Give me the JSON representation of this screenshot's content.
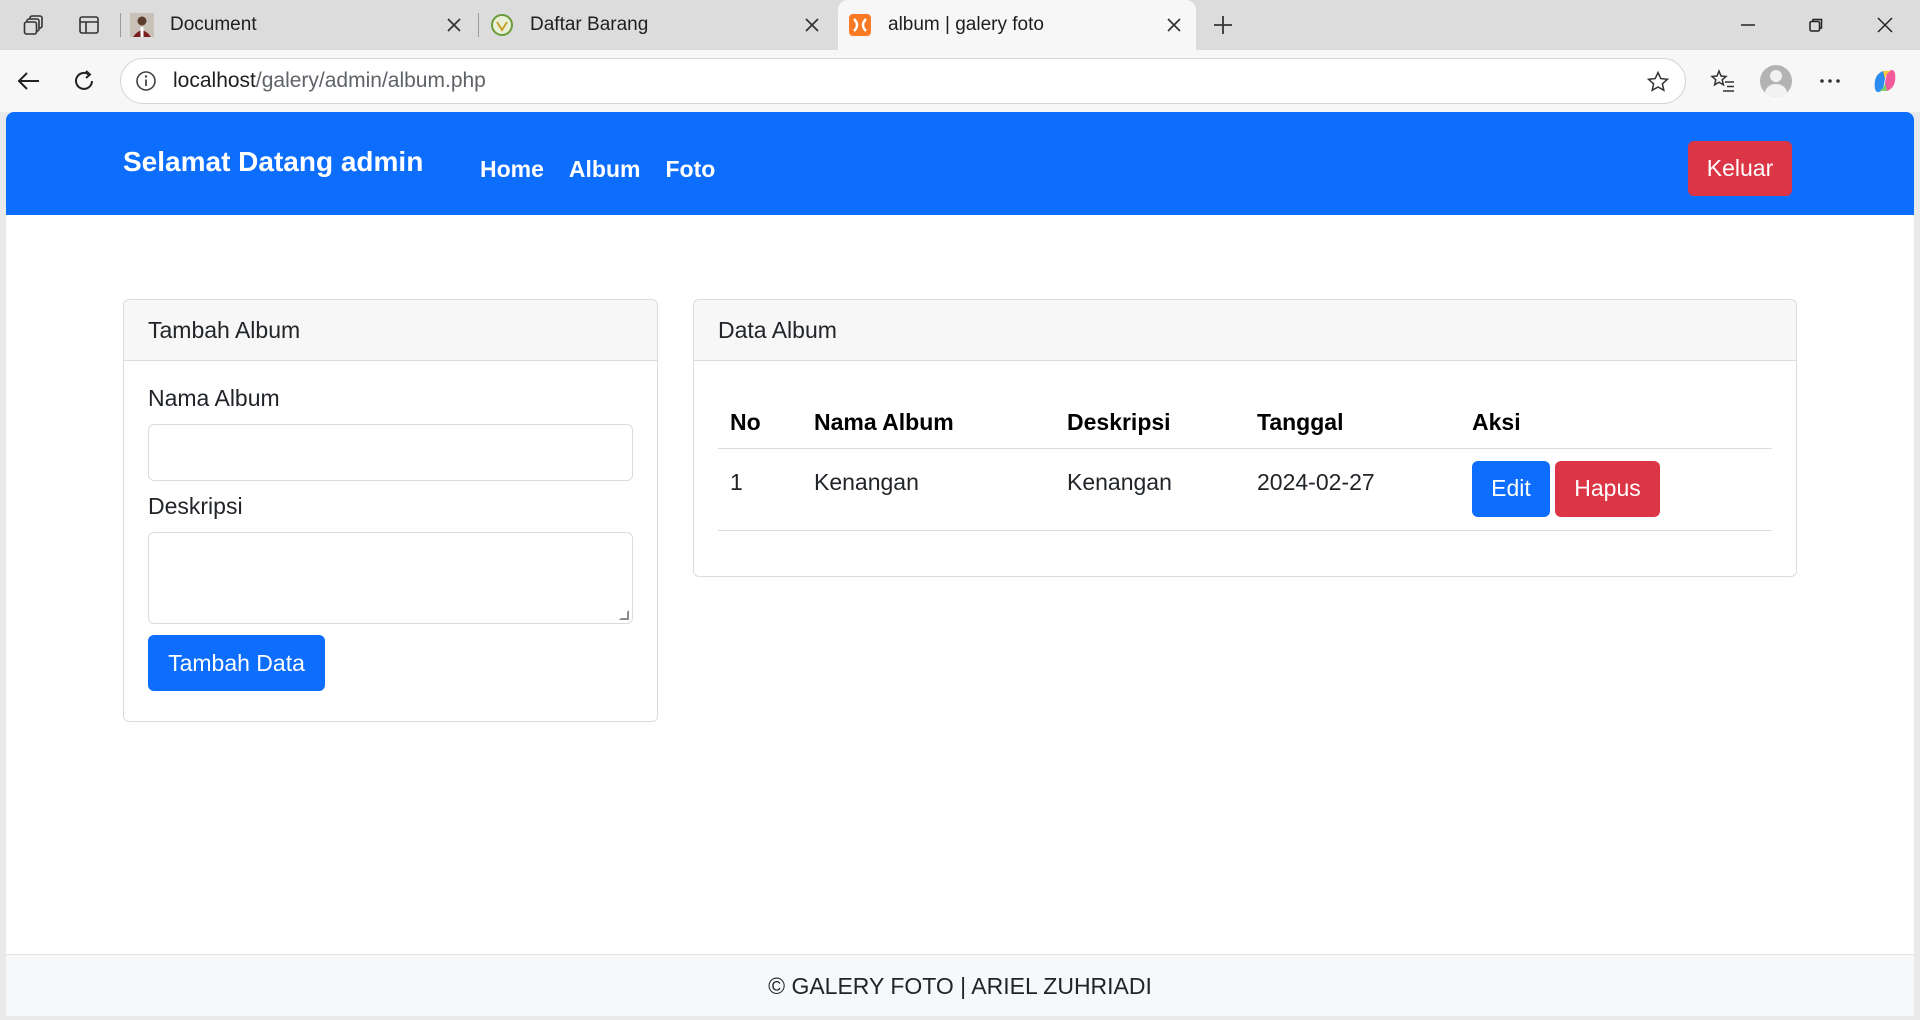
{
  "browser": {
    "tabs": [
      {
        "title": "Document",
        "favicon": "person-photo-icon"
      },
      {
        "title": "Daftar Barang",
        "favicon": "green-logo-icon"
      },
      {
        "title": "album | galery foto",
        "favicon": "xampp-icon"
      }
    ],
    "url_host": "localhost",
    "url_path": "/galery/admin/album.php"
  },
  "navbar": {
    "brand": "Selamat Datang admin",
    "links": [
      "Home",
      "Album",
      "Foto"
    ],
    "logout_label": "Keluar",
    "color": "#0d6efd"
  },
  "add_album": {
    "header": "Tambah Album",
    "name_label": "Nama Album",
    "name_value": "",
    "desc_label": "Deskripsi",
    "desc_value": "",
    "submit_label": "Tambah Data"
  },
  "data_album": {
    "header": "Data Album",
    "columns": [
      "No",
      "Nama Album",
      "Deskripsi",
      "Tanggal",
      "Aksi"
    ],
    "rows": [
      {
        "no": "1",
        "nama": "Kenangan",
        "deskripsi": "Kenangan",
        "tanggal": "2024-02-27",
        "edit_label": "Edit",
        "delete_label": "Hapus"
      }
    ]
  },
  "footer": {
    "text": "© GALERY FOTO | ARIEL ZUHRIADI"
  },
  "colors": {
    "primary": "#0d6efd",
    "danger": "#dc3545"
  }
}
